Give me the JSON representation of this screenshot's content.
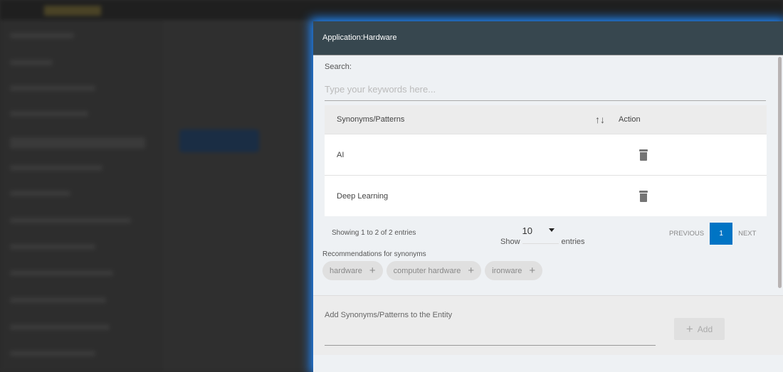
{
  "modal": {
    "title": "Application:Hardware"
  },
  "search": {
    "label": "Search:",
    "placeholder": "Type your keywords here..."
  },
  "table": {
    "headers": [
      "Synonyms/Patterns",
      "Action"
    ],
    "sort_icon": "↑↓",
    "rows": [
      {
        "value": "AI"
      },
      {
        "value": "Deep Learning"
      }
    ]
  },
  "footer": {
    "info": "Showing 1 to 2 of 2 entries",
    "show_label": "Show",
    "page_size": "10",
    "entries_label": "entries",
    "previous": "PREVIOUS",
    "current_page": "1",
    "next": "NEXT"
  },
  "recommendations": {
    "label": "Recommendations for synonyms",
    "plus": "+",
    "chips": [
      "hardware",
      "computer hardware",
      "ironware"
    ]
  },
  "add": {
    "label": "Add Synonyms/Patterns to the Entity",
    "button": "Add",
    "plus": "+"
  },
  "colors": {
    "header": "#37474f",
    "accent": "#0074c4",
    "glow": "#1e88ff"
  }
}
